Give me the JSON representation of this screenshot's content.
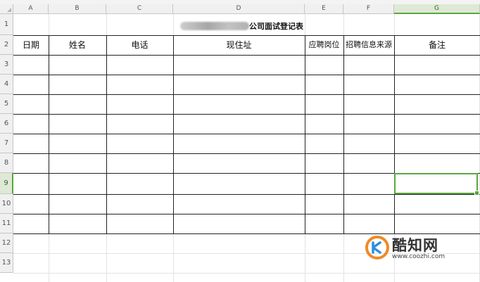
{
  "sheet": {
    "columns": [
      "A",
      "B",
      "C",
      "D",
      "E",
      "F",
      "G"
    ],
    "rows": [
      "1",
      "2",
      "3",
      "4",
      "5",
      "6",
      "7",
      "8",
      "9",
      "10",
      "11",
      "12",
      "13"
    ],
    "active_column": "G",
    "active_row": "9",
    "title_text": "公司面试登记表",
    "headers": [
      "日期",
      "姓名",
      "电话",
      "现住址",
      "应聘岗位",
      "招聘信息来源",
      "备注"
    ]
  },
  "watermark": {
    "name": "酷知网",
    "url": "www.coozhi.com",
    "colors": {
      "orange": "#f08a24",
      "blue": "#2f8fdc"
    }
  },
  "colors": {
    "selection": "#5aa73f",
    "border": "#222222",
    "gridline": "#e3e3e3"
  }
}
